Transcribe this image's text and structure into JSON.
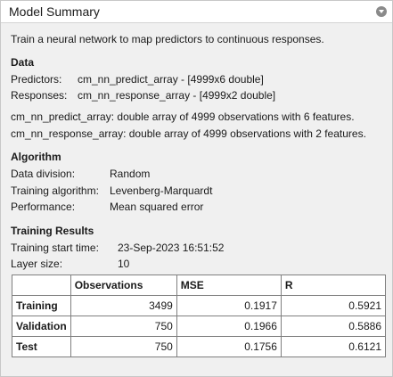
{
  "panel": {
    "title": "Model Summary",
    "description": "Train a neural network to map predictors to continuous responses."
  },
  "data_section": {
    "heading": "Data",
    "predictors_label": "Predictors:",
    "predictors_value": "cm_nn_predict_array - [4999x6 double]",
    "responses_label": "Responses:",
    "responses_value": "cm_nn_response_array - [4999x2 double]",
    "predict_desc": "cm_nn_predict_array: double array of 4999 observations with 6 features.",
    "response_desc": "cm_nn_response_array: double array of 4999 observations with 2 features."
  },
  "algorithm": {
    "heading": "Algorithm",
    "division_label": "Data division:",
    "division_value": "Random",
    "training_label": "Training algorithm:",
    "training_value": "Levenberg-Marquardt",
    "performance_label": "Performance:",
    "performance_value": "Mean squared error"
  },
  "results": {
    "heading": "Training Results",
    "start_label": "Training start time:",
    "start_value": "23-Sep-2023 16:51:52",
    "layer_label": "Layer size:",
    "layer_value": "10",
    "table": {
      "headers": [
        "",
        "Observations",
        "MSE",
        "R"
      ],
      "rows": [
        {
          "name": "Training",
          "observations": "3499",
          "mse": "0.1917",
          "r": "0.5921"
        },
        {
          "name": "Validation",
          "observations": "750",
          "mse": "0.1966",
          "r": "0.5886"
        },
        {
          "name": "Test",
          "observations": "750",
          "mse": "0.1756",
          "r": "0.6121"
        }
      ]
    }
  },
  "icons": {
    "collapse": "collapse-chevron-icon"
  }
}
